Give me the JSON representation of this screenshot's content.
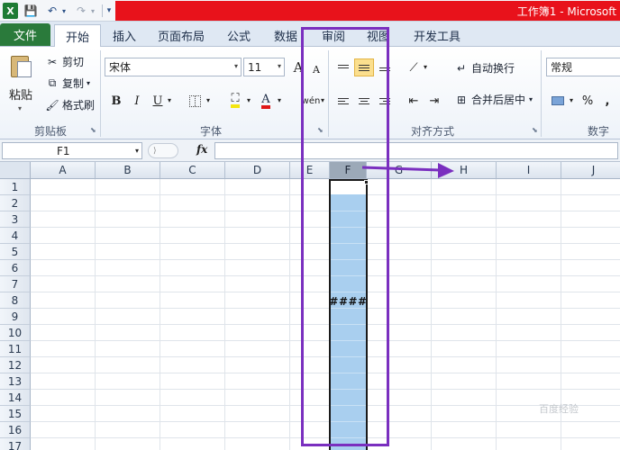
{
  "titlebar": {
    "title": "工作簿1 - Microsoft"
  },
  "quick_access": {
    "logo": "X",
    "save": "💾",
    "undo": "↶",
    "redo": "↷",
    "dropdown": "▾",
    "more": "▾"
  },
  "tabs": [
    {
      "label": "文件",
      "active": false
    },
    {
      "label": "开始",
      "active": true
    },
    {
      "label": "插入",
      "active": false
    },
    {
      "label": "页面布局",
      "active": false
    },
    {
      "label": "公式",
      "active": false
    },
    {
      "label": "数据",
      "active": false
    },
    {
      "label": "审阅",
      "active": false
    },
    {
      "label": "视图",
      "active": false
    },
    {
      "label": "开发工具",
      "active": false
    }
  ],
  "ribbon": {
    "clipboard": {
      "group_label": "剪贴板",
      "paste": "粘贴",
      "cut": "剪切",
      "copy": "复制",
      "format_painter": "格式刷"
    },
    "font": {
      "group_label": "字体",
      "font_name": "宋体",
      "font_size": "11",
      "bold": "B",
      "italic": "I",
      "underline": "U",
      "grow": "A",
      "shrink": "A",
      "phonetic": "wén"
    },
    "alignment": {
      "group_label": "对齐方式",
      "wrap_text": "自动换行",
      "merge_center": "合并后居中"
    },
    "number": {
      "group_label": "数字",
      "format": "常规",
      "percent": "%",
      "comma": ","
    }
  },
  "formula_bar": {
    "name_box": "F1",
    "fx_label": "fx",
    "value": ""
  },
  "sheet": {
    "columns": [
      "A",
      "B",
      "C",
      "D",
      "E",
      "F",
      "G",
      "H",
      "I",
      "J"
    ],
    "selected_column": "F",
    "rows": [
      "1",
      "2",
      "3",
      "4",
      "5",
      "6",
      "7",
      "8",
      "9",
      "10",
      "11",
      "12",
      "13",
      "14",
      "15",
      "16",
      "17"
    ],
    "cell_f8": "####"
  },
  "colors": {
    "annotation": "#7a2fbf",
    "selection_fill": "#a9cfef",
    "title_red": "#e8121b",
    "file_tab": "#2a7a3b"
  },
  "watermark": "百度经验"
}
